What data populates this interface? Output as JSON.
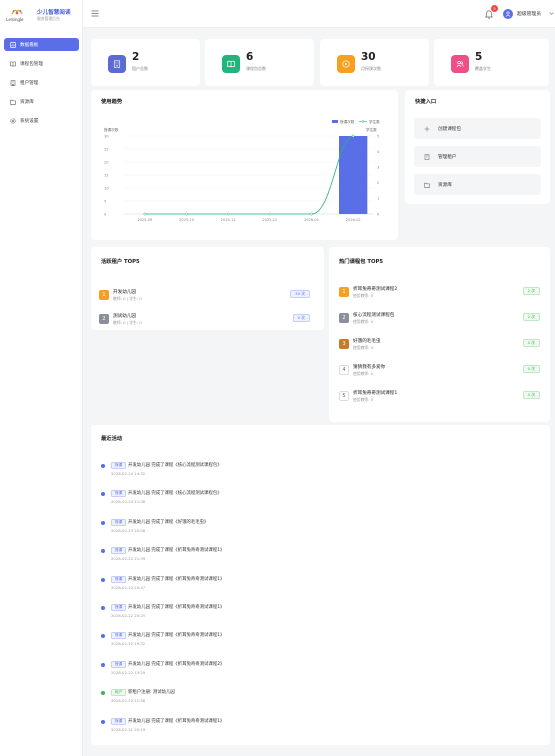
{
  "brand": {
    "name": "少儿智慧阅读",
    "subtitle": "服务管理后台",
    "mark_text": "LeSingle"
  },
  "sidebar": {
    "items": [
      {
        "label": "数据看板",
        "icon": "dashboard-icon",
        "active": true
      },
      {
        "label": "课程包管理",
        "icon": "book-icon",
        "active": false
      },
      {
        "label": "租户管理",
        "icon": "building-icon",
        "active": false
      },
      {
        "label": "资源库",
        "icon": "folder-icon",
        "active": false
      },
      {
        "label": "系统设置",
        "icon": "gear-icon",
        "active": false
      }
    ]
  },
  "topbar": {
    "notification_count": "5",
    "user_name": "超级管理员"
  },
  "stats": [
    {
      "value": "2",
      "label": "租户总数",
      "color": "#5b6bd6",
      "icon": "building-icon"
    },
    {
      "value": "6",
      "label": "课程包总数",
      "color": "#21b47d",
      "icon": "book-icon"
    },
    {
      "value": "30",
      "label": "月授课次数",
      "color": "#f5a020",
      "icon": "play-icon"
    },
    {
      "value": "5",
      "label": "覆盖学生",
      "color": "#ef4f86",
      "icon": "users-icon"
    }
  ],
  "usage": {
    "title": "使用趋势"
  },
  "chart_data": {
    "type": "bar+line",
    "categories": [
      "2025-09",
      "2025-10",
      "2025-11",
      "2025-12",
      "2026-01",
      "2026-02"
    ],
    "series": [
      {
        "name": "授课次数",
        "type": "bar",
        "axis": "left",
        "values": [
          0,
          0,
          0,
          0,
          0,
          30
        ],
        "color": "#5a6ee8"
      },
      {
        "name": "学生数",
        "type": "line",
        "axis": "right",
        "values": [
          0,
          0,
          0,
          0,
          0,
          5
        ],
        "color": "#22b573"
      }
    ],
    "ylabel_left": "授课次数",
    "ylabel_right": "学生数",
    "ylim_left": [
      0,
      30
    ],
    "ylim_right": [
      0,
      5
    ],
    "yticks_left": [
      "0",
      "5",
      "10",
      "15",
      "20",
      "25",
      "30"
    ],
    "yticks_right": [
      "0",
      "1",
      "2",
      "3",
      "4",
      "5"
    ],
    "legend": "top-right",
    "grid": true
  },
  "quick": {
    "title": "快捷入口",
    "items": [
      {
        "label": "创建课程包",
        "icon": "plus-icon"
      },
      {
        "label": "管理租户",
        "icon": "building-icon"
      },
      {
        "label": "资源库",
        "icon": "folder-icon"
      }
    ]
  },
  "tenants": {
    "title": "活跃租户 TOP5",
    "rows": [
      {
        "rank": "1",
        "name": "开发幼儿园",
        "sub": "教师: 0 | 学生: 0",
        "badge": "30 次",
        "rank_color": "#f5a020"
      },
      {
        "rank": "2",
        "name": "测试幼儿园",
        "sub": "教师: 0 | 学生: 0",
        "badge": "0 次",
        "rank_color": "#8a8f99"
      }
    ]
  },
  "courses": {
    "title": "热门课程包 TOP5",
    "rows": [
      {
        "rank": "1",
        "name": "折耳兔奇奇测试课程2",
        "sub": "使用教师: 0",
        "badge": "2 次",
        "rank_color": "#f5a020"
      },
      {
        "rank": "2",
        "name": "核心流程测试课程包",
        "sub": "使用教师: 0",
        "badge": "2 次",
        "rank_color": "#8a8f99"
      },
      {
        "rank": "3",
        "name": "好饿的毛毛虫",
        "sub": "使用教师: 0",
        "badge": "0 次",
        "rank_color": "#c77a2a"
      },
      {
        "rank": "4",
        "name": "猜猜我有多爱你",
        "sub": "使用教师: 0",
        "badge": "0 次",
        "rank_color": ""
      },
      {
        "rank": "5",
        "name": "折耳兔奇奇测试课程1",
        "sub": "使用教师: 0",
        "badge": "0 次",
        "rank_color": ""
      }
    ]
  },
  "activity": {
    "title": "最近活动",
    "items": [
      {
        "tag": "授课",
        "text": "开发幼儿园 完成了课程《核心流程测试课程包》",
        "time": "2026-02-24 14:32",
        "kind": "blue"
      },
      {
        "tag": "授课",
        "text": "开发幼儿园 完成了课程《核心流程测试课程包》",
        "time": "2026-02-24 11:08",
        "kind": "blue"
      },
      {
        "tag": "授课",
        "text": "开发幼儿园 完成了课程《好饿的毛毛虫》",
        "time": "2026-02-23 20:06",
        "kind": "blue"
      },
      {
        "tag": "授课",
        "text": "开发幼儿园 完成了课程《折耳兔奇奇测试课程1》",
        "time": "2026-02-22 21:39",
        "kind": "blue"
      },
      {
        "tag": "授课",
        "text": "开发幼儿园 完成了课程《折耳兔奇奇测试课程1》",
        "time": "2026-02-22 20:47",
        "kind": "blue"
      },
      {
        "tag": "授课",
        "text": "开发幼儿园 完成了课程《折耳兔奇奇测试课程1》",
        "time": "2026-02-22 20:25",
        "kind": "blue"
      },
      {
        "tag": "授课",
        "text": "开发幼儿园 完成了课程《折耳兔奇奇测试课程1》",
        "time": "2026-02-22 19:32",
        "kind": "blue"
      },
      {
        "tag": "授课",
        "text": "开发幼儿园 完成了课程《折耳兔奇奇测试课程2》",
        "time": "2026-02-22 15:29",
        "kind": "blue"
      },
      {
        "tag": "租户",
        "text": "新租户注册: 测试幼儿园",
        "time": "2026-02-22 11:58",
        "kind": "green"
      },
      {
        "tag": "授课",
        "text": "开发幼儿园 完成了课程《折耳兔奇奇测试课程1》",
        "time": "2026-02-21 20:19",
        "kind": "blue"
      }
    ]
  }
}
